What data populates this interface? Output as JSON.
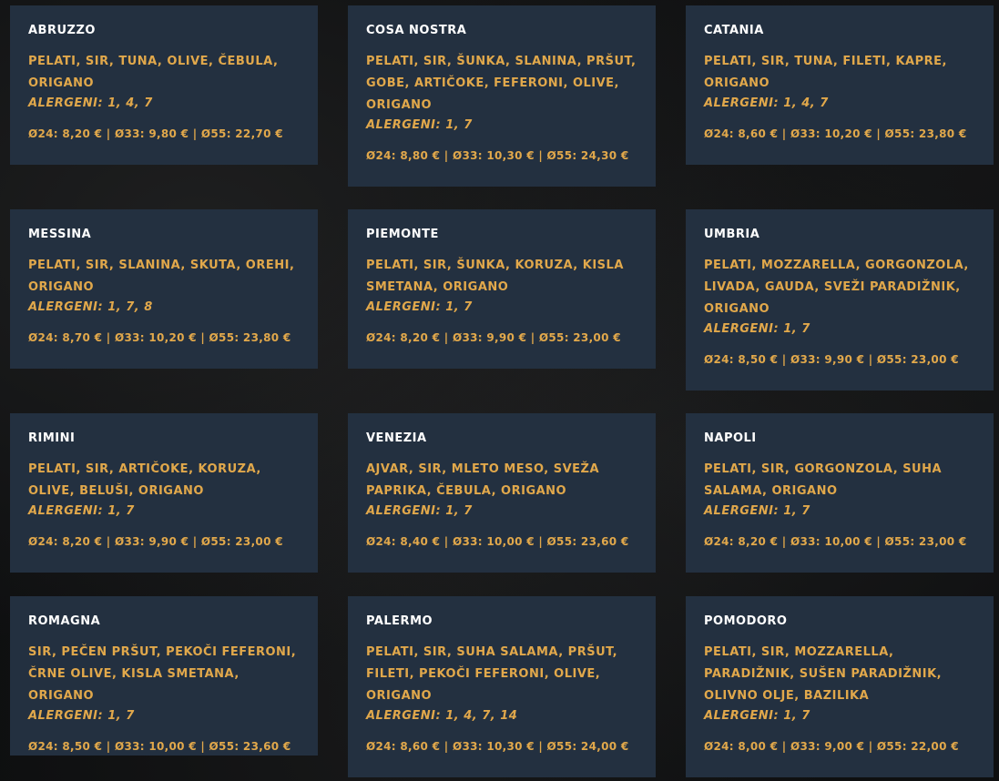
{
  "pizzas": [
    {
      "name": "ABRUZZO",
      "ingredients": "PELATI, SIR, TUNA, OLIVE, ČEBULA, ORIGANO",
      "allergens": "ALERGENI: 1, 4, 7",
      "price": "Ø24: 8,20 € | Ø33: 9,80 € | Ø55: 22,70 €"
    },
    {
      "name": "COSA NOSTRA",
      "ingredients": "PELATI, SIR, ŠUNKA, SLANINA, PRŠUT, GOBE, ARTIČOKE, FEFERONI, OLIVE, ORIGANO",
      "allergens": "ALERGENI: 1, 7",
      "price": "Ø24: 8,80 € | Ø33: 10,30 € | Ø55: 24,30 €"
    },
    {
      "name": "CATANIA",
      "ingredients": "PELATI, SIR, TUNA, FILETI, KAPRE, ORIGANO",
      "allergens": "ALERGENI: 1, 4, 7",
      "price": "Ø24: 8,60 € | Ø33: 10,20 € | Ø55: 23,80 €"
    },
    {
      "name": "MESSINA",
      "ingredients": "PELATI, SIR, SLANINA, SKUTA, OREHI, ORIGANO",
      "allergens": "ALERGENI: 1, 7, 8",
      "price": "Ø24: 8,70 € | Ø33: 10,20 € | Ø55: 23,80 €"
    },
    {
      "name": "PIEMONTE",
      "ingredients": "PELATI, SIR, ŠUNKA, KORUZA, KISLA SMETANA, ORIGANO",
      "allergens": "ALERGENI: 1, 7",
      "price": "Ø24: 8,20 € | Ø33: 9,90 € | Ø55: 23,00 €"
    },
    {
      "name": "UMBRIA",
      "ingredients": "PELATI, MOZZARELLA, GORGONZOLA, LIVADA, GAUDA, SVEŽI PARADIŽNIK, ORIGANO",
      "allergens": "ALERGENI: 1, 7",
      "price": "Ø24: 8,50 € | Ø33: 9,90 € | Ø55: 23,00 €"
    },
    {
      "name": "RIMINI",
      "ingredients": "PELATI, SIR, ARTIČOKE, KORUZA, OLIVE, BELUŠI, ORIGANO",
      "allergens": "ALERGENI: 1, 7",
      "price": "Ø24: 8,20 € | Ø33: 9,90 € | Ø55: 23,00 €"
    },
    {
      "name": "VENEZIA",
      "ingredients": "AJVAR, SIR, MLETO MESO, SVEŽA PAPRIKA, ČEBULA, ORIGANO",
      "allergens": "ALERGENI: 1, 7",
      "price": "Ø24: 8,40 € | Ø33: 10,00 € | Ø55: 23,60 €"
    },
    {
      "name": "NAPOLI",
      "ingredients": "PELATI, SIR, GORGONZOLA, SUHA SALAMA, ORIGANO",
      "allergens": "ALERGENI: 1, 7",
      "price": "Ø24: 8,20 € | Ø33: 10,00 € | Ø55: 23,00 €"
    },
    {
      "name": "ROMAGNA",
      "ingredients": "SIR, PEČEN PRŠUT, PEKOČI FEFERONI, ČRNE OLIVE, KISLA SMETANA, ORIGANO",
      "allergens": "ALERGENI: 1, 7",
      "price": "Ø24: 8,50 € | Ø33: 10,00 € | Ø55: 23,60 €"
    },
    {
      "name": "PALERMO",
      "ingredients": "PELATI, SIR, SUHA SALAMA, PRŠUT, FILETI, PEKOČI FEFERONI, OLIVE, ORIGANO",
      "allergens": "ALERGENI: 1, 4, 7, 14",
      "price": "Ø24: 8,60 € | Ø33: 10,30 € | Ø55: 24,00 €"
    },
    {
      "name": "POMODORO",
      "ingredients": "PELATI, SIR, MOZZARELLA, PARADIŽNIK, SUŠEN PARADIŽNIK, OLIVNO OLJE, BAZILIKA",
      "allergens": "ALERGENI: 1, 7",
      "price": "Ø24: 8,00 € | Ø33: 9,00 € | Ø55: 22,00 €"
    }
  ]
}
